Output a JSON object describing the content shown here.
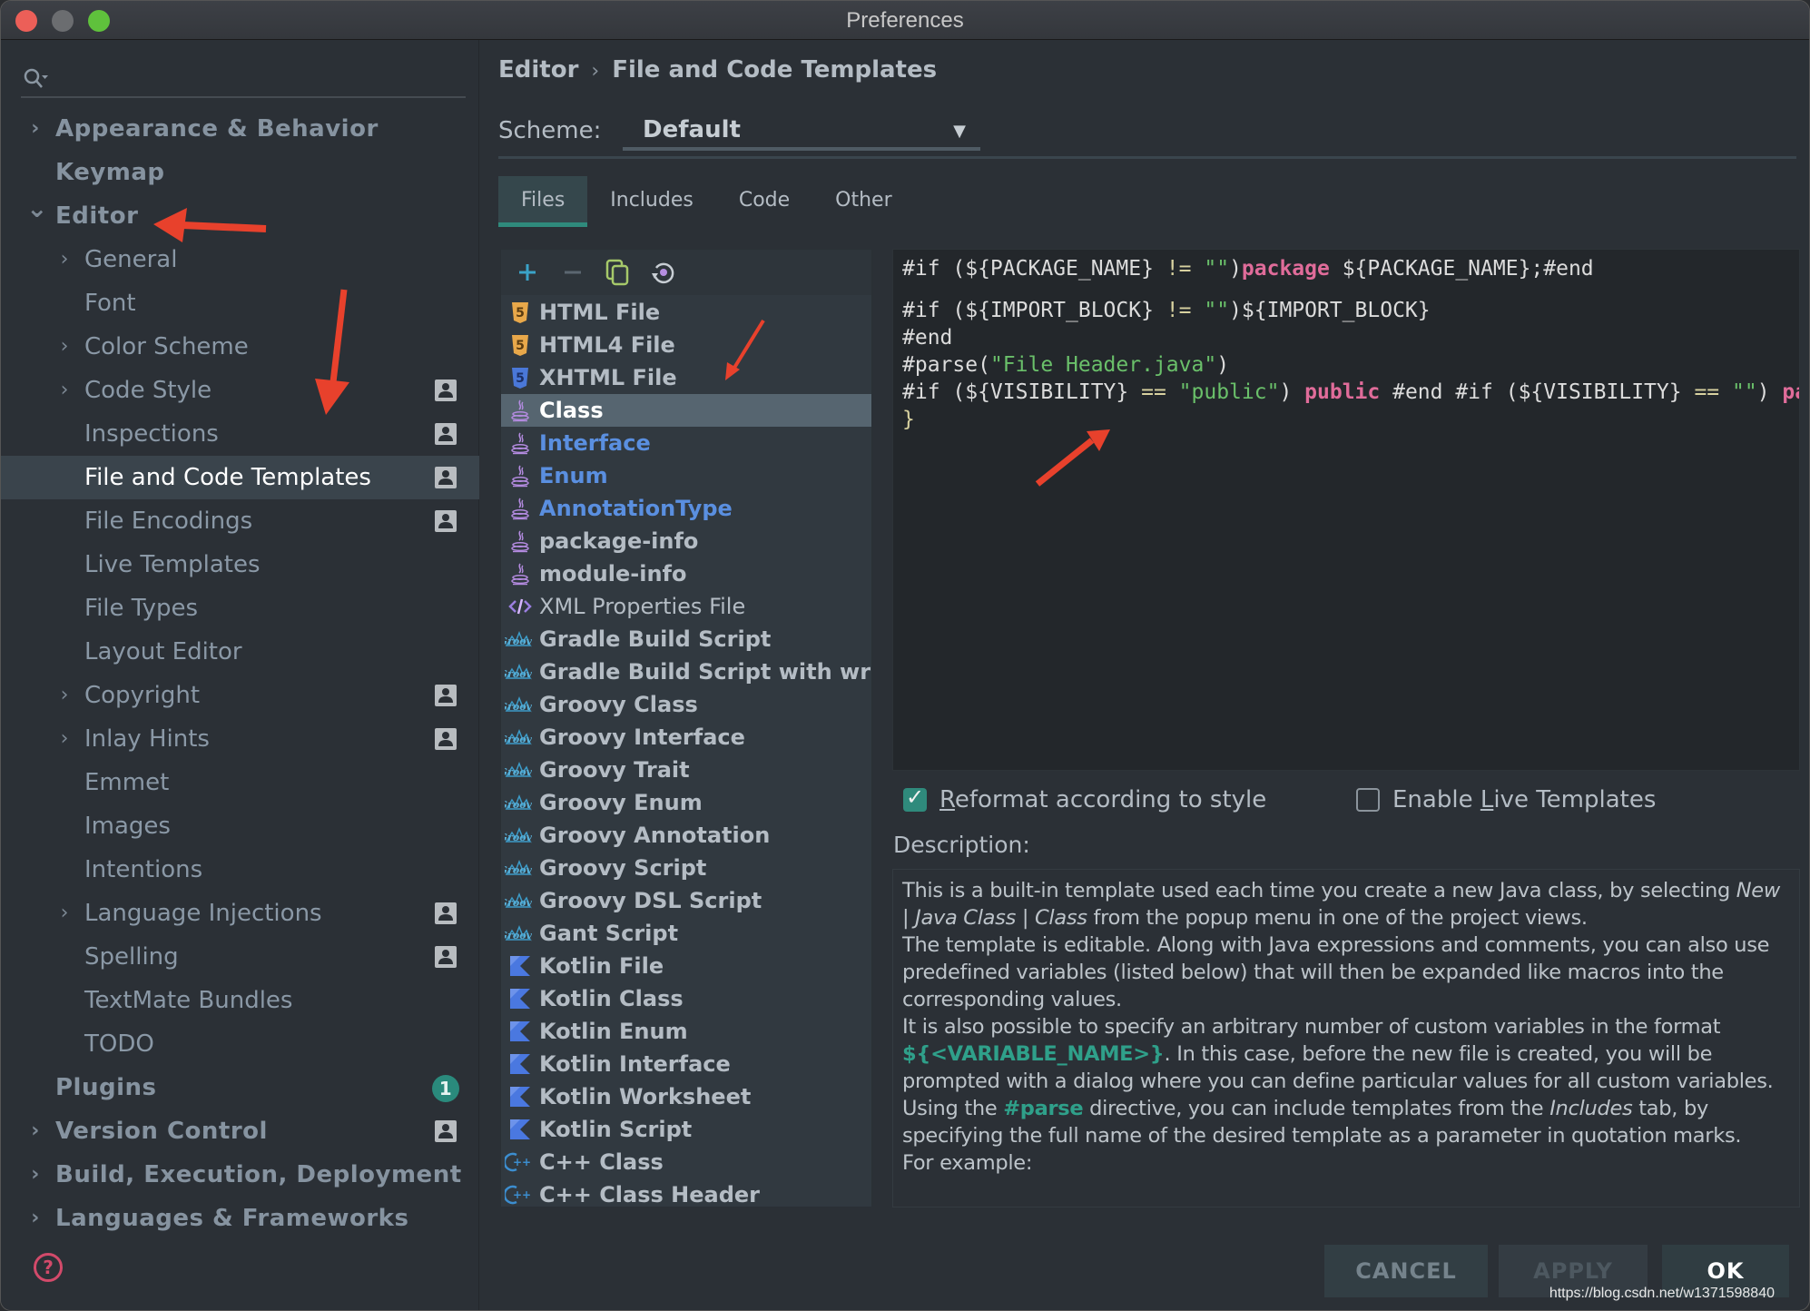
{
  "window": {
    "title": "Preferences"
  },
  "sidebar": {
    "search_placeholder": "",
    "items": [
      {
        "label": "Appearance & Behavior",
        "level": 0,
        "expandable": true,
        "expanded": false,
        "bold": true,
        "badge": null
      },
      {
        "label": "Keymap",
        "level": 0,
        "expandable": false,
        "bold": true,
        "badge": null
      },
      {
        "label": "Editor",
        "level": 0,
        "expandable": true,
        "expanded": true,
        "bold": true,
        "badge": null
      },
      {
        "label": "General",
        "level": 1,
        "expandable": true,
        "expanded": false,
        "badge": null
      },
      {
        "label": "Font",
        "level": 1,
        "expandable": false,
        "badge": null
      },
      {
        "label": "Color Scheme",
        "level": 1,
        "expandable": true,
        "expanded": false,
        "badge": null
      },
      {
        "label": "Code Style",
        "level": 1,
        "expandable": true,
        "expanded": false,
        "badge": "project"
      },
      {
        "label": "Inspections",
        "level": 1,
        "expandable": false,
        "badge": "project"
      },
      {
        "label": "File and Code Templates",
        "level": 1,
        "expandable": false,
        "badge": "project",
        "selected": true
      },
      {
        "label": "File Encodings",
        "level": 1,
        "expandable": false,
        "badge": "project"
      },
      {
        "label": "Live Templates",
        "level": 1,
        "expandable": false,
        "badge": null
      },
      {
        "label": "File Types",
        "level": 1,
        "expandable": false,
        "badge": null
      },
      {
        "label": "Layout Editor",
        "level": 1,
        "expandable": false,
        "badge": null
      },
      {
        "label": "Copyright",
        "level": 1,
        "expandable": true,
        "expanded": false,
        "badge": "project"
      },
      {
        "label": "Inlay Hints",
        "level": 1,
        "expandable": true,
        "expanded": false,
        "badge": "project"
      },
      {
        "label": "Emmet",
        "level": 1,
        "expandable": false,
        "badge": null
      },
      {
        "label": "Images",
        "level": 1,
        "expandable": false,
        "badge": null
      },
      {
        "label": "Intentions",
        "level": 1,
        "expandable": false,
        "badge": null
      },
      {
        "label": "Language Injections",
        "level": 1,
        "expandable": true,
        "expanded": false,
        "badge": "project"
      },
      {
        "label": "Spelling",
        "level": 1,
        "expandable": false,
        "badge": "project"
      },
      {
        "label": "TextMate Bundles",
        "level": 1,
        "expandable": false,
        "badge": null
      },
      {
        "label": "TODO",
        "level": 1,
        "expandable": false,
        "badge": null
      },
      {
        "label": "Plugins",
        "level": 0,
        "expandable": false,
        "bold": true,
        "badge": "1"
      },
      {
        "label": "Version Control",
        "level": 0,
        "expandable": true,
        "expanded": false,
        "bold": true,
        "badge": "project"
      },
      {
        "label": "Build, Execution, Deployment",
        "level": 0,
        "expandable": true,
        "expanded": false,
        "bold": true,
        "badge": null
      },
      {
        "label": "Languages & Frameworks",
        "level": 0,
        "expandable": true,
        "expanded": false,
        "bold": true,
        "badge": null
      }
    ]
  },
  "header": {
    "breadcrumb": [
      "Editor",
      "File and Code Templates"
    ],
    "scheme_label": "Scheme:",
    "scheme_value": "Default"
  },
  "tabs": [
    {
      "label": "Files",
      "active": true
    },
    {
      "label": "Includes",
      "active": false
    },
    {
      "label": "Code",
      "active": false
    },
    {
      "label": "Other",
      "active": false
    }
  ],
  "toolbar": {
    "add": "add-icon",
    "remove": "remove-icon",
    "copy": "copy-icon",
    "reset": "reset-icon"
  },
  "templates": [
    {
      "label": "HTML File",
      "icon": "html5",
      "style": "bold"
    },
    {
      "label": "HTML4 File",
      "icon": "html5",
      "style": "bold"
    },
    {
      "label": "XHTML File",
      "icon": "xhtml",
      "style": "bold"
    },
    {
      "label": "Class",
      "icon": "java",
      "style": "bold",
      "selected": true
    },
    {
      "label": "Interface",
      "icon": "java",
      "style": "blue"
    },
    {
      "label": "Enum",
      "icon": "java",
      "style": "blue"
    },
    {
      "label": "AnnotationType",
      "icon": "java",
      "style": "blue"
    },
    {
      "label": "package-info",
      "icon": "java",
      "style": "bold"
    },
    {
      "label": "module-info",
      "icon": "java",
      "style": "bold"
    },
    {
      "label": "XML Properties File",
      "icon": "xml",
      "style": "plain"
    },
    {
      "label": "Gradle Build Script",
      "icon": "groovy",
      "style": "bold"
    },
    {
      "label": "Gradle Build Script with wrapper",
      "icon": "groovy",
      "style": "bold"
    },
    {
      "label": "Groovy Class",
      "icon": "groovy",
      "style": "bold"
    },
    {
      "label": "Groovy Interface",
      "icon": "groovy",
      "style": "bold"
    },
    {
      "label": "Groovy Trait",
      "icon": "groovy",
      "style": "bold"
    },
    {
      "label": "Groovy Enum",
      "icon": "groovy",
      "style": "bold"
    },
    {
      "label": "Groovy Annotation",
      "icon": "groovy",
      "style": "bold"
    },
    {
      "label": "Groovy Script",
      "icon": "groovy",
      "style": "bold"
    },
    {
      "label": "Groovy DSL Script",
      "icon": "groovy",
      "style": "bold"
    },
    {
      "label": "Gant Script",
      "icon": "groovy",
      "style": "bold"
    },
    {
      "label": "Kotlin File",
      "icon": "kotlin",
      "style": "bold"
    },
    {
      "label": "Kotlin Class",
      "icon": "kotlin",
      "style": "bold"
    },
    {
      "label": "Kotlin Enum",
      "icon": "kotlin",
      "style": "bold"
    },
    {
      "label": "Kotlin Interface",
      "icon": "kotlin",
      "style": "bold"
    },
    {
      "label": "Kotlin Worksheet",
      "icon": "kotlin",
      "style": "bold"
    },
    {
      "label": "Kotlin Script",
      "icon": "kotlin",
      "style": "bold"
    },
    {
      "label": "C++ Class",
      "icon": "cpp",
      "style": "bold"
    },
    {
      "label": "C++ Class Header",
      "icon": "cpp",
      "style": "bold"
    }
  ],
  "editor": {
    "lines": [
      [
        {
          "t": "#if (${PACKAGE_NAME} "
        },
        {
          "t": "!=",
          "c": "op"
        },
        {
          "t": " "
        },
        {
          "t": "\"\"",
          "c": "str"
        },
        {
          "t": ")"
        },
        {
          "t": "package",
          "c": "kw"
        },
        {
          "t": " ${PACKAGE_NAME};#end"
        }
      ],
      [],
      [
        {
          "t": "#if (${IMPORT_BLOCK} "
        },
        {
          "t": "!=",
          "c": "op"
        },
        {
          "t": " "
        },
        {
          "t": "\"\"",
          "c": "str"
        },
        {
          "t": ")${IMPORT_BLOCK}"
        }
      ],
      [
        {
          "t": "#end"
        }
      ],
      [
        {
          "t": "#parse("
        },
        {
          "t": "\"File Header.java\"",
          "c": "str"
        },
        {
          "t": ")"
        }
      ],
      [
        {
          "t": "#if (${VISIBILITY} "
        },
        {
          "t": "==",
          "c": "op"
        },
        {
          "t": " "
        },
        {
          "t": "\"public\"",
          "c": "str"
        },
        {
          "t": ") "
        },
        {
          "t": "public",
          "c": "kw"
        },
        {
          "t": " #end #if (${VISIBILITY} "
        },
        {
          "t": "==",
          "c": "op"
        },
        {
          "t": " "
        },
        {
          "t": "\"\"",
          "c": "str"
        },
        {
          "t": ") "
        },
        {
          "t": "package",
          "c": "kw"
        }
      ],
      [
        {
          "t": "}",
          "c": "op"
        }
      ]
    ]
  },
  "options": {
    "reformat_label": "Reformat according to style",
    "reformat_mnemonic": "R",
    "reformat_checked": true,
    "live_templates_label_pre": "Enable ",
    "live_templates_mnemonic": "L",
    "live_templates_label_post": "ive Templates",
    "live_templates_checked": false
  },
  "description": {
    "label": "Description:",
    "paragraphs": [
      [
        {
          "t": "This is a built-in template used each time you create a new Java class, by selecting "
        },
        {
          "t": "New | Java Class | Class",
          "s": "em"
        },
        {
          "t": " from the popup menu in one of the project views."
        }
      ],
      [
        {
          "t": "The template is editable. Along with Java expressions and comments, you can also use predefined variables (listed below) that will then be expanded like macros into the corresponding values."
        }
      ],
      [
        {
          "t": "It is also possible to specify an arbitrary number of custom variables in the format "
        },
        {
          "t": "${<VARIABLE_NAME>}",
          "s": "code"
        },
        {
          "t": ". In this case, before the new file is created, you will be prompted with a dialog where you can define particular values for all custom variables."
        }
      ],
      [
        {
          "t": "Using the "
        },
        {
          "t": "#parse",
          "s": "code"
        },
        {
          "t": " directive, you can include templates from the "
        },
        {
          "t": "Includes",
          "s": "em"
        },
        {
          "t": " tab, by specifying the full name of the desired template as a parameter in quotation marks."
        }
      ],
      [
        {
          "t": "For example:"
        }
      ]
    ]
  },
  "buttons": {
    "cancel": "CANCEL",
    "apply": "APPLY",
    "ok": "OK"
  },
  "watermark": "https://blog.csdn.net/w1371598840",
  "colors": {
    "accent": "#2f8a7c",
    "keyword": "#e06c9a",
    "string": "#6ac06a",
    "link_blue": "#5a8fe0",
    "annotation_red": "#e8412c"
  }
}
